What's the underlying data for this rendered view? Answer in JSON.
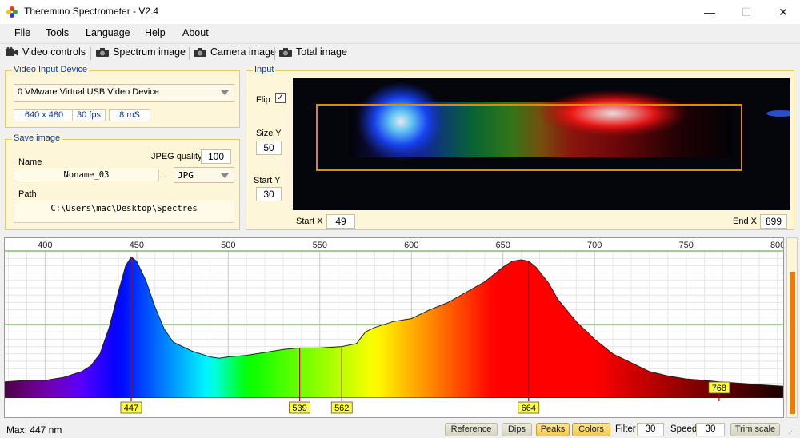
{
  "window": {
    "title": "Theremino Spectrometer - V2.4",
    "minimize": "—",
    "maximize": "☐",
    "close": "✕"
  },
  "menu": [
    "File",
    "Tools",
    "Language",
    "Help",
    "About"
  ],
  "toolbar": [
    "Video controls",
    "Spectrum image",
    "Camera image",
    "Total image"
  ],
  "video_input": {
    "legend": "Video Input Device",
    "device": "0 VMware Virtual USB Video Device",
    "resolution": "640 x 480",
    "fps": "30 fps",
    "latency": "8 mS"
  },
  "save_image": {
    "legend": "Save image",
    "name_label": "Name",
    "jpeg_quality_label": "JPEG quality",
    "jpeg_quality": "100",
    "name": "Noname_03",
    "dot": ".",
    "format": "JPG",
    "path_label": "Path",
    "path": "C:\\Users\\mac\\Desktop\\Spectres"
  },
  "input": {
    "legend": "Input",
    "flip_label": "Flip",
    "flip_checked": true,
    "size_y_label": "Size Y",
    "size_y": "50",
    "start_y_label": "Start Y",
    "start_y": "30",
    "start_x_label": "Start X",
    "start_x": "49",
    "end_x_label": "End X",
    "end_x": "899"
  },
  "chart_data": {
    "type": "area",
    "x_ticks": [
      400,
      450,
      500,
      550,
      600,
      650,
      700,
      750,
      800
    ],
    "xlim": [
      378,
      803
    ],
    "ylim": [
      0,
      100
    ],
    "grid": true,
    "x": [
      378,
      390,
      400,
      410,
      420,
      425,
      430,
      435,
      440,
      444,
      447,
      450,
      455,
      460,
      465,
      470,
      480,
      490,
      495,
      500,
      510,
      520,
      530,
      539,
      550,
      562,
      570,
      575,
      580,
      590,
      600,
      610,
      620,
      630,
      640,
      650,
      655,
      660,
      664,
      668,
      675,
      680,
      690,
      700,
      710,
      720,
      730,
      740,
      750,
      760,
      768,
      780,
      790,
      803
    ],
    "y": [
      11,
      12,
      12,
      14,
      18,
      22,
      30,
      48,
      72,
      90,
      96,
      93,
      80,
      62,
      47,
      38,
      32,
      28,
      27,
      28,
      29,
      31,
      33,
      34,
      34,
      35,
      37,
      45,
      48,
      52,
      54,
      60,
      65,
      72,
      79,
      89,
      93,
      94,
      93,
      89,
      78,
      67,
      52,
      40,
      30,
      24,
      18,
      15,
      13,
      12,
      11,
      10,
      9,
      8
    ],
    "peaks": [
      447,
      539,
      562,
      664,
      768
    ]
  },
  "status": {
    "max": "Max: 447 nm",
    "reference": "Reference",
    "dips": "Dips",
    "peaks": "Peaks",
    "colors": "Colors",
    "filter_label": "Filter",
    "filter": "30",
    "speed_label": "Speed",
    "speed": "30",
    "trim": "Trim scale",
    "level": 0.85
  }
}
